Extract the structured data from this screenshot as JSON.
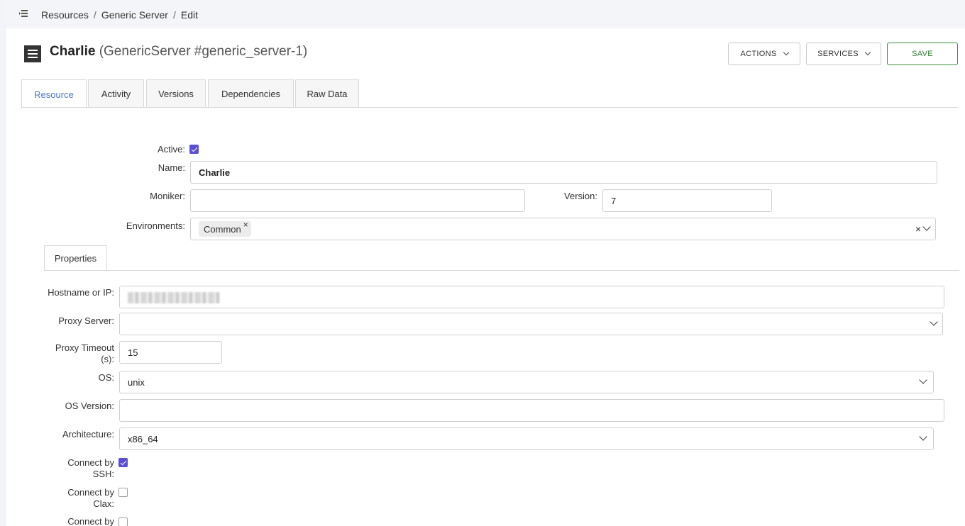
{
  "breadcrumb": {
    "items": [
      "Resources",
      "Generic Server",
      "Edit"
    ],
    "separator": "/"
  },
  "header": {
    "name": "Charlie",
    "subtitle": "(GenericServer #generic_server-1)",
    "actions_label": "ACTIONS",
    "services_label": "SERVICES",
    "save_label": "SAVE"
  },
  "tabs": [
    "Resource",
    "Activity",
    "Versions",
    "Dependencies",
    "Raw Data"
  ],
  "active_tab": "Resource",
  "form": {
    "active_label": "Active:",
    "active": true,
    "name_label": "Name:",
    "name_value": "Charlie",
    "moniker_label": "Moniker:",
    "moniker_value": "",
    "version_label": "Version:",
    "version_value": "7",
    "environments_label": "Environments:",
    "environments": [
      "Common"
    ],
    "chip_remove": "×",
    "clear_all": "×"
  },
  "properties": {
    "tab_label": "Properties",
    "hostname_label": "Hostname or IP:",
    "hostname_value": "",
    "proxy_server_label": "Proxy Server:",
    "proxy_server_value": "",
    "proxy_timeout_label_1": "Proxy Timeout",
    "proxy_timeout_label_2": "(s):",
    "proxy_timeout_value": "15",
    "os_label": "OS:",
    "os_value": "unix",
    "os_version_label": "OS Version:",
    "os_version_value": "",
    "architecture_label": "Architecture:",
    "architecture_value": "x86_64",
    "ssh_label_1": "Connect by",
    "ssh_label_2": "SSH:",
    "ssh_checked": true,
    "clax_label_1": "Connect by",
    "clax_label_2": "Clax:",
    "clax_checked": false,
    "next_label_1": "Connect by",
    "next_checked": false
  },
  "colors": {
    "accent": "#5b4fd6",
    "active_tab": "#4a73c9",
    "save": "#2e7d32"
  },
  "icons": [
    "menu-collapse-icon",
    "document-list-icon",
    "chevron-down-icon",
    "checkbox-icon"
  ]
}
